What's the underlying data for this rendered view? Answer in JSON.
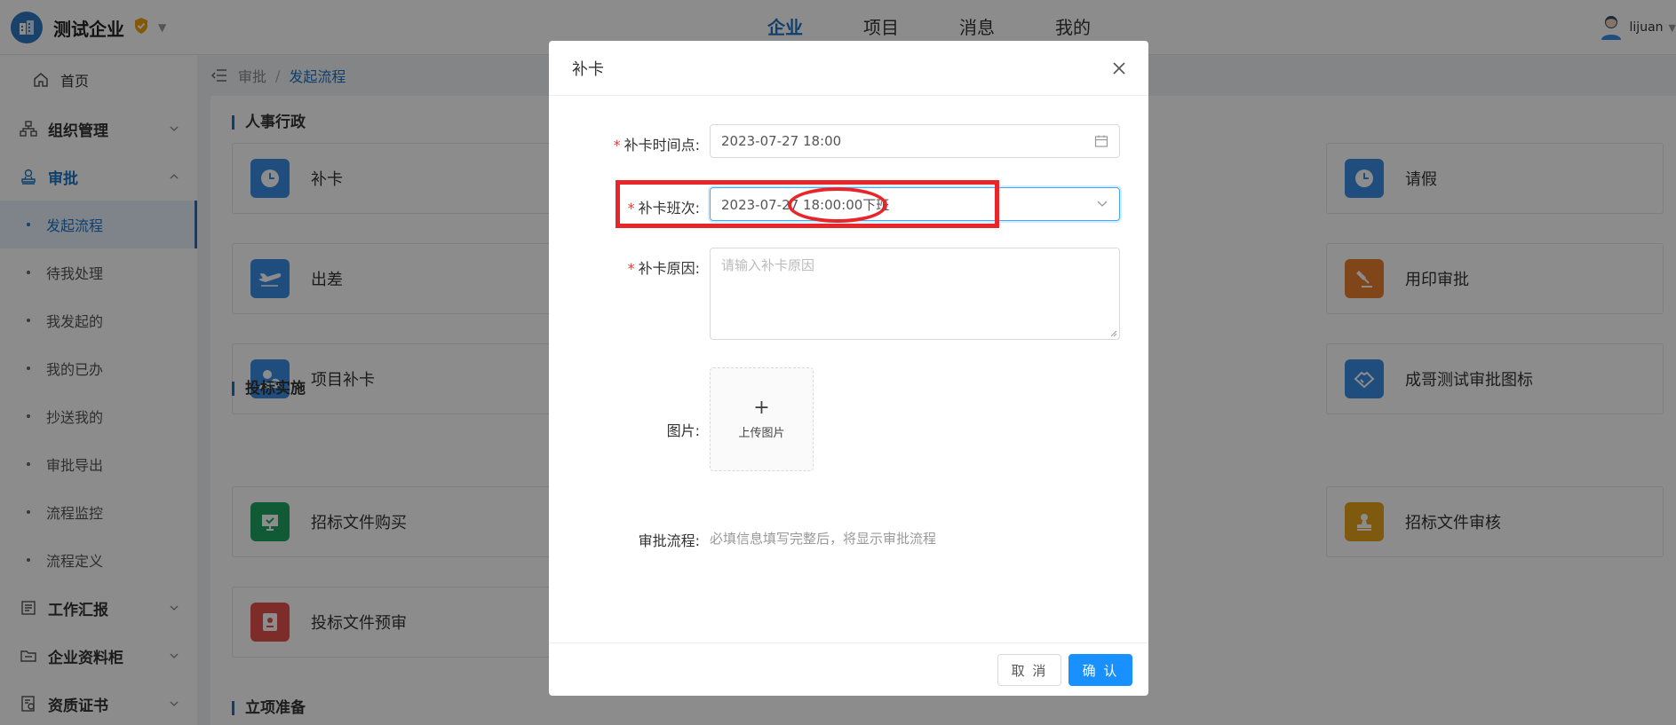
{
  "topbar": {
    "brand_name": "测试企业",
    "nav": [
      "企业",
      "项目",
      "消息",
      "我的"
    ],
    "active_nav": "企业",
    "user_name": "lijuan"
  },
  "sidebar": {
    "home": "首页",
    "groups": [
      {
        "label": "组织管理",
        "icon": "org-icon"
      },
      {
        "label": "审批",
        "icon": "approval-icon",
        "open": true
      },
      {
        "label": "工作汇报",
        "icon": "report-icon"
      },
      {
        "label": "企业资料柜",
        "icon": "folder-icon"
      },
      {
        "label": "资质证书",
        "icon": "certificate-icon"
      }
    ],
    "approval_items": [
      "发起流程",
      "待我处理",
      "我发起的",
      "我的已办",
      "抄送我的",
      "审批导出",
      "流程监控",
      "流程定义"
    ],
    "active_item": "发起流程"
  },
  "breadcrumb": {
    "parent": "审批",
    "sep": "/",
    "current": "发起流程"
  },
  "sections": [
    {
      "title": "人事行政"
    },
    {
      "title": "投标实施"
    },
    {
      "title": "立项准备"
    }
  ],
  "cards": {
    "c1": "补卡",
    "c2": "出差",
    "c3": "项目补卡",
    "c4": "招标文件购买",
    "c5": "投标文件预审",
    "r1": "请假",
    "r2": "用印审批",
    "r3": "成哥测试审批图标",
    "r4": "招标文件审核"
  },
  "colors": {
    "primary": "#1d74c5",
    "button_primary": "#1890ff",
    "required": "#e53e3e",
    "annotation": "#e8262a"
  },
  "modal": {
    "title": "补卡",
    "fields": {
      "time_label": "补卡时间点:",
      "time_value": "2023-07-27 18:00",
      "shift_label": "补卡班次:",
      "shift_value": "2023-07-27 18:00:00下班",
      "reason_label": "补卡原因:",
      "reason_placeholder": "请输入补卡原因",
      "image_label": "图片:",
      "upload_text": "上传图片",
      "flow_label": "审批流程:",
      "flow_hint": "必填信息填写完整后，将显示审批流程"
    },
    "cancel": "取 消",
    "confirm": "确 认"
  }
}
